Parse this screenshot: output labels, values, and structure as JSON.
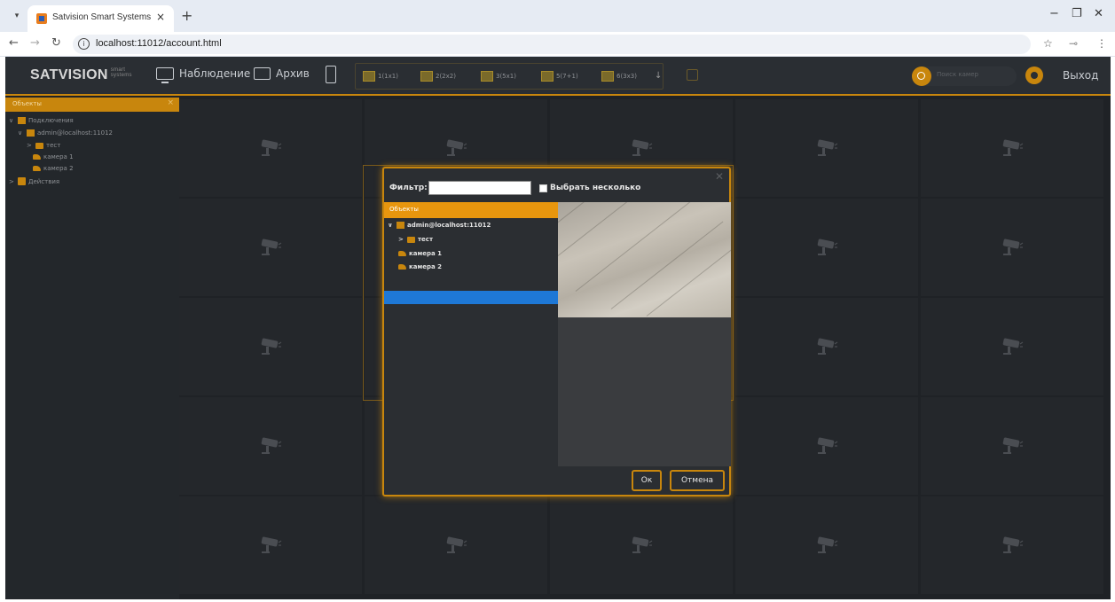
{
  "browser": {
    "tab_title": "Satvision Smart Systems: Набл",
    "tab_close": "×",
    "new_tab": "+",
    "url": "localhost:11012/account.html",
    "window": {
      "minimize": "−",
      "restore": "❐",
      "close": "✕"
    }
  },
  "toolbar": {
    "logo": "SATVISION",
    "logo_small": "smart systems",
    "observation": "Наблюдение",
    "archive": "Архив",
    "layouts": [
      "1(1x1)",
      "2(2x2)",
      "3(5x1)",
      "5(7+1)",
      "6(3x3)"
    ],
    "search_placeholder": "Поиск камер",
    "logout": "Выход"
  },
  "sidebar": {
    "header": "Объекты",
    "items": [
      {
        "chevron": "∨",
        "label": "Подключения"
      },
      {
        "chevron": "∨",
        "label": "admin@localhost:11012"
      },
      {
        "chevron": ">",
        "label": "тест"
      },
      {
        "chevron": "",
        "label": "камера 1"
      },
      {
        "chevron": "",
        "label": "камера 2"
      },
      {
        "chevron": ">",
        "label": "Действия"
      }
    ]
  },
  "dialog": {
    "filter_label": "Фильтр:",
    "filter_value": "",
    "multi_label": "Выбрать несколько",
    "tree_header": "Объекты",
    "tree": [
      {
        "chevron": "∨",
        "label": "admin@localhost:11012"
      },
      {
        "chevron": ">",
        "label": "тест"
      },
      {
        "chevron": "",
        "label": "камера 1"
      },
      {
        "chevron": "",
        "label": "камера 2"
      }
    ],
    "ok": "Ок",
    "cancel": "Отмена",
    "close": "✕"
  },
  "colors": {
    "accent": "#c8860d",
    "selection": "#1e78d6",
    "background": "#1f2226"
  }
}
